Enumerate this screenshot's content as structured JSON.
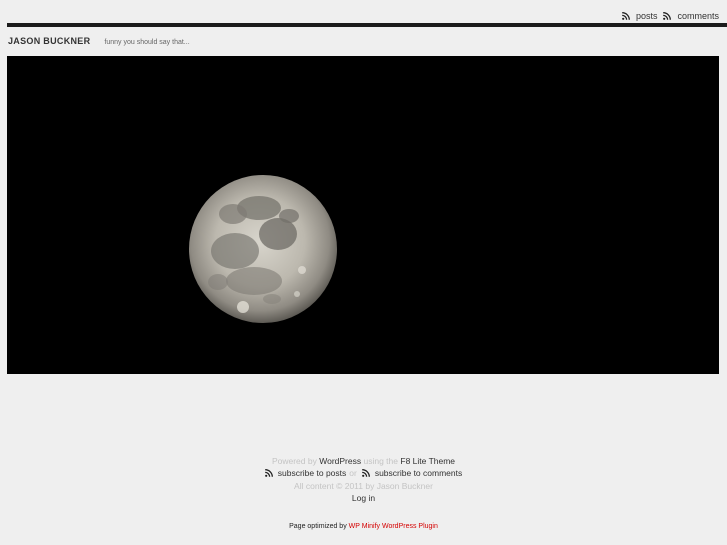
{
  "top": {
    "posts_label": "posts",
    "comments_label": "comments"
  },
  "header": {
    "site_title": "JASON BUCKNER",
    "tagline": "funny you should say that..."
  },
  "photo": {
    "subject": "full moon on black sky"
  },
  "footer": {
    "powered_by": "Powered by",
    "wordpress": "WordPress",
    "using_the": "using the",
    "theme": "F8 Lite Theme",
    "subscribe_posts": "subscribe to posts",
    "or": "or",
    "subscribe_comments": "subscribe to comments",
    "copyright": "All content © 2011 by Jason Buckner",
    "login": "Log in"
  },
  "optimized": {
    "prefix": "Page optimized by",
    "plugin": "WP Minify WordPress Plugin"
  },
  "colors": {
    "bar": "#1b1b1b",
    "background": "#efefef",
    "plugin_link": "#d40000"
  }
}
